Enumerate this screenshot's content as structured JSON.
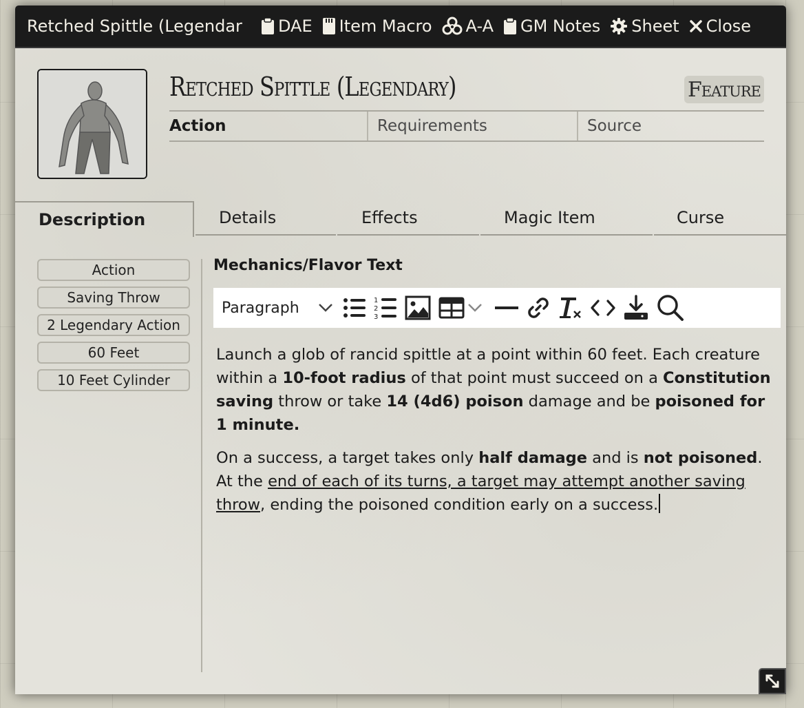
{
  "window": {
    "title": "Retched Spittle (Legendar",
    "header_buttons": [
      {
        "label": "DAE",
        "icon": "clipboard-icon"
      },
      {
        "label": "Item Macro",
        "icon": "sticky-note-icon"
      },
      {
        "label": "A-A",
        "icon": "biohazard-icon"
      },
      {
        "label": "GM Notes",
        "icon": "clipboard-icon"
      },
      {
        "label": "Sheet",
        "icon": "gear-icon"
      },
      {
        "label": "Close",
        "icon": "close-icon"
      }
    ]
  },
  "item": {
    "name": "Retched Spittle (Legendary)",
    "type": "Feature",
    "activation": "Action",
    "requirements_placeholder": "Requirements",
    "source_placeholder": "Source"
  },
  "tabs": [
    "Description",
    "Details",
    "Effects",
    "Magic Item",
    "Curse"
  ],
  "properties": [
    "Action",
    "Saving Throw",
    "2 Legendary Action",
    "60 Feet",
    "10 Feet Cylinder"
  ],
  "editor": {
    "label": "Mechanics/Flavor Text",
    "format_select": "Paragraph",
    "toolbar_icons": [
      "bullet-list-icon",
      "numbered-list-icon",
      "image-icon",
      "table-icon",
      "horizontal-rule-icon",
      "link-icon",
      "clear-format-icon",
      "code-icon",
      "save-icon",
      "search-icon"
    ],
    "p1": {
      "t1": "Launch a glob of rancid spittle at a point within 60 feet. Each creature within a ",
      "b1": "10-foot radius",
      "t2": " of that point must succeed on a ",
      "b2": "Constitution saving",
      "t3": " throw or take ",
      "b3": "14 (4d6) poison",
      "t4": " damage and be ",
      "b4": "poisoned for 1 minute."
    },
    "p2": {
      "t1": "On a success, a target takes only ",
      "b1": "half damage",
      "t2": " and is ",
      "b2": "not poisoned",
      "t3": ". At the ",
      "u1": "end of each of its turns, a target may attempt another saving throw",
      "t4": ", ending the poisoned condition early on a success."
    }
  }
}
